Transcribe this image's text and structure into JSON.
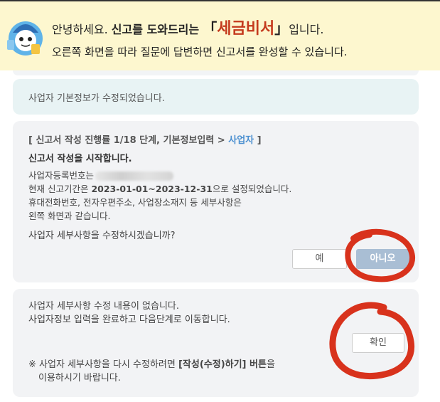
{
  "banner": {
    "greeting": "안녕하세요. ",
    "intro_bold": "신고를 도와드리는",
    "bracket_open": "「",
    "brand": "세금비서",
    "bracket_close": "」",
    "suffix": "입니다.",
    "line2": "오른쪽 화면을 따라 질문에 답변하면 신고서를 완성할 수 있습니다."
  },
  "info_message": "사업자 기본정보가 수정되었습니다.",
  "question": {
    "header_prefix": "[ 신고서 작성 진행률 1/18 단계, 기본정보입력 > ",
    "header_highlight": "사업자",
    "header_suffix": " ]",
    "title": "신고서 작성을 시작합니다.",
    "reg_label": "사업자등록번호는",
    "period_prefix": "현재 신고기간은 ",
    "period_value": "2023-01-01~2023-12-31",
    "period_suffix": "으로 설정되었습니다.",
    "detail_line1": "휴대전화번호, 전자우편주소, 사업장소재지 등 세부사항은",
    "detail_line2": "왼쪽 화면과 같습니다.",
    "ask": "사업자 세부사항을 수정하시겠습니까?",
    "yes_label": "예",
    "no_label": "아니오"
  },
  "answer": {
    "line1": "사업자 세부사항 수정 내용이 없습니다.",
    "line2": "사업자정보 입력을 완료하고 다음단계로 이동합니다.",
    "ok_label": "확인",
    "note_prefix": "※ 사업자 세부사항을 다시 수정하려면 ",
    "note_bold": "[작성(수정)하기] 버튼",
    "note_suffix": "을",
    "note_line2": "이용하시기 바랍니다."
  },
  "colors": {
    "banner_bg": "#fdf7cf",
    "brand_red": "#c43a1d",
    "highlight_blue": "#4a8fd0",
    "no_button": "#a9bed4",
    "annotation_red": "#d8321c"
  },
  "icons": {
    "mascot": "mascot-icon"
  }
}
